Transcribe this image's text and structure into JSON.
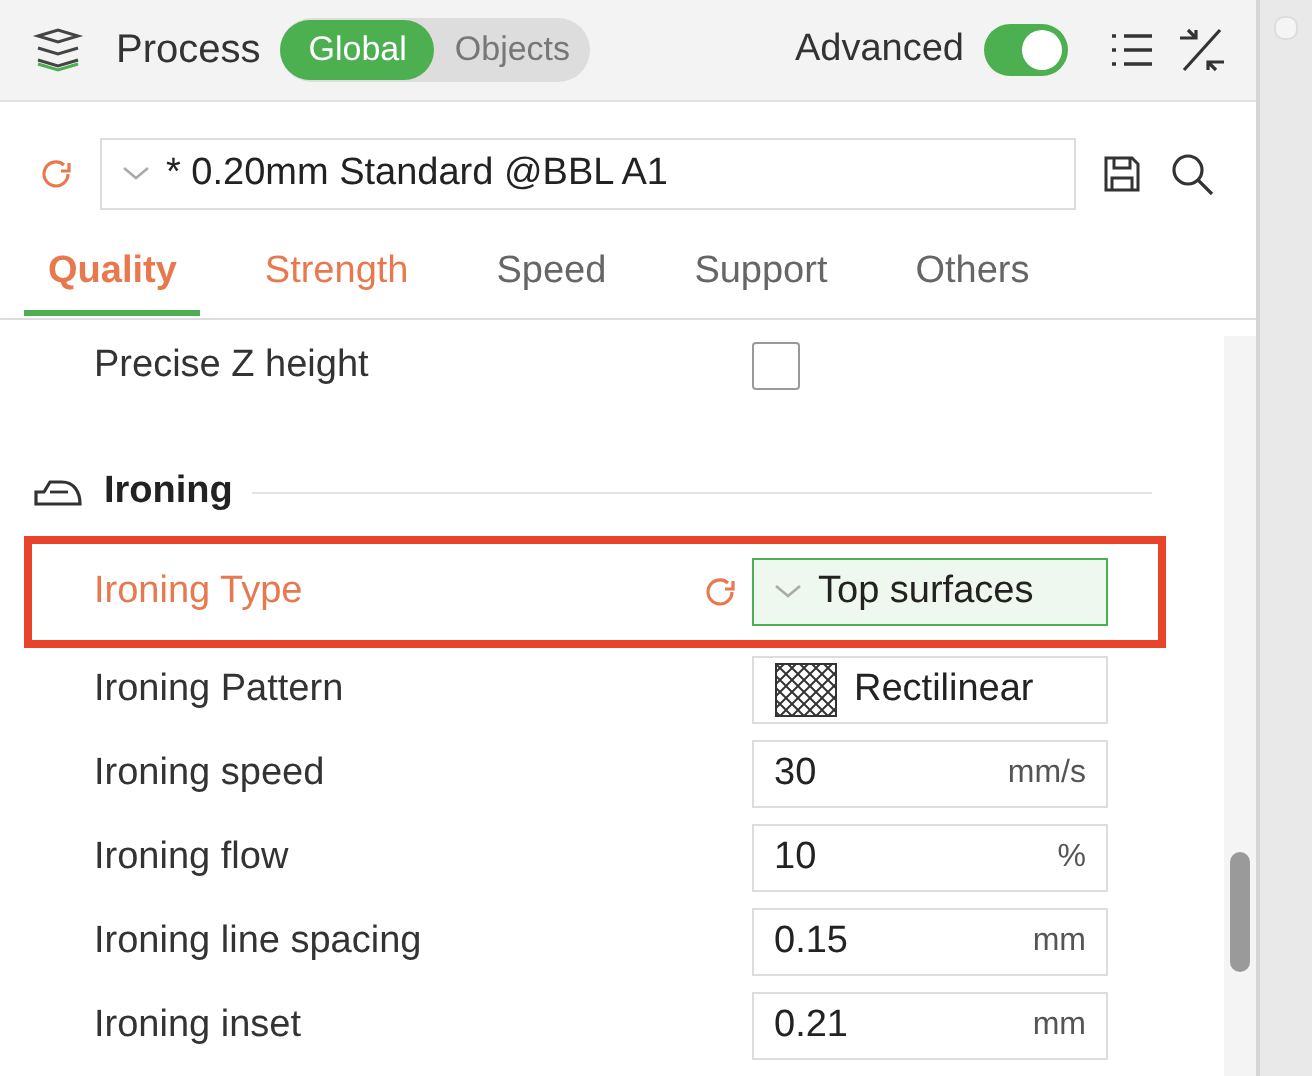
{
  "header": {
    "title": "Process",
    "scope": [
      {
        "label": "Global",
        "selected": true
      },
      {
        "label": "Objects",
        "selected": false
      }
    ],
    "advanced": {
      "label": "Advanced",
      "on": true
    }
  },
  "preset": {
    "value": "* 0.20mm Standard @BBL A1"
  },
  "tabs": [
    {
      "label": "Quality",
      "selected": true,
      "modified": true
    },
    {
      "label": "Strength",
      "selected": false,
      "modified": true
    },
    {
      "label": "Speed",
      "selected": false,
      "modified": false
    },
    {
      "label": "Support",
      "selected": false,
      "modified": false
    },
    {
      "label": "Others",
      "selected": false,
      "modified": false
    }
  ],
  "rows": [
    {
      "kind": "checkbox",
      "label": "Precise Z height",
      "checked": false,
      "modified": false,
      "highlighted": false
    },
    {
      "kind": "section",
      "label": "Ironing"
    },
    {
      "kind": "dropdown",
      "label": "Ironing Type",
      "value": "Top surfaces",
      "modified": true,
      "highlighted": true
    },
    {
      "kind": "pattern",
      "label": "Ironing Pattern",
      "value": "Rectilinear",
      "modified": false,
      "highlighted": false
    },
    {
      "kind": "number",
      "label": "Ironing speed",
      "value": "30",
      "unit": "mm/s",
      "modified": false,
      "highlighted": false
    },
    {
      "kind": "number",
      "label": "Ironing flow",
      "value": "10",
      "unit": "%",
      "modified": false,
      "highlighted": false
    },
    {
      "kind": "number",
      "label": "Ironing line spacing",
      "value": "0.15",
      "unit": "mm",
      "modified": false,
      "highlighted": false
    },
    {
      "kind": "number",
      "label": "Ironing inset",
      "value": "0.21",
      "unit": "mm",
      "modified": false,
      "highlighted": false
    }
  ]
}
